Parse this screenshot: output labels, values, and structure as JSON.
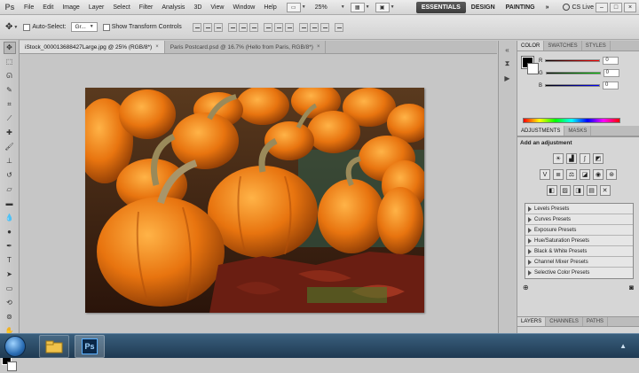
{
  "app": {
    "logo": "Ps"
  },
  "menubar": {
    "items": [
      "File",
      "Edit",
      "Image",
      "Layer",
      "Select",
      "Filter",
      "Analysis",
      "3D",
      "View",
      "Window",
      "Help"
    ],
    "zoom": "25%",
    "workspaces": [
      "ESSENTIALS",
      "DESIGN",
      "PAINTING"
    ],
    "more": "»",
    "cslive": "CS Live",
    "window_buttons": [
      "–",
      "□",
      "×"
    ]
  },
  "options": {
    "auto_select_label": "Auto-Select:",
    "auto_select_value": "Gr...",
    "show_transform_label": "Show Transform Controls"
  },
  "documents": {
    "tabs": [
      {
        "label": "iStock_000013688427Large.jpg @ 25% (RGB/8*)",
        "active": true
      },
      {
        "label": "Paris Postcard.psd @ 16.7% (Hello from Paris, RGB/8*)",
        "active": false
      }
    ],
    "close": "×"
  },
  "tools": [
    "move",
    "marquee",
    "lasso",
    "quick-select",
    "crop",
    "eyedropper",
    "spot-heal",
    "brush",
    "clone-stamp",
    "history-brush",
    "eraser",
    "gradient",
    "blur",
    "dodge",
    "pen",
    "type",
    "path-select",
    "shape",
    "3d-rotate",
    "3d-orbit",
    "hand",
    "zoom"
  ],
  "color_panel": {
    "tabs": [
      "COLOR",
      "SWATCHES",
      "STYLES"
    ],
    "channels": [
      {
        "label": "R",
        "value": "0",
        "color": "#ff0000"
      },
      {
        "label": "G",
        "value": "0",
        "color": "#00c000"
      },
      {
        "label": "B",
        "value": "0",
        "color": "#0000ff"
      }
    ]
  },
  "adjustments": {
    "tabs": [
      "ADJUSTMENTS",
      "MASKS"
    ],
    "title": "Add an adjustment",
    "presets": [
      "Levels Presets",
      "Curves Presets",
      "Exposure Presets",
      "Hue/Saturation Presets",
      "Black & White Presets",
      "Channel Mixer Presets",
      "Selective Color Presets"
    ]
  },
  "layers": {
    "tabs": [
      "LAYERS",
      "CHANNELS",
      "PATHS"
    ]
  },
  "taskbar": {
    "ps_label": "Ps"
  }
}
